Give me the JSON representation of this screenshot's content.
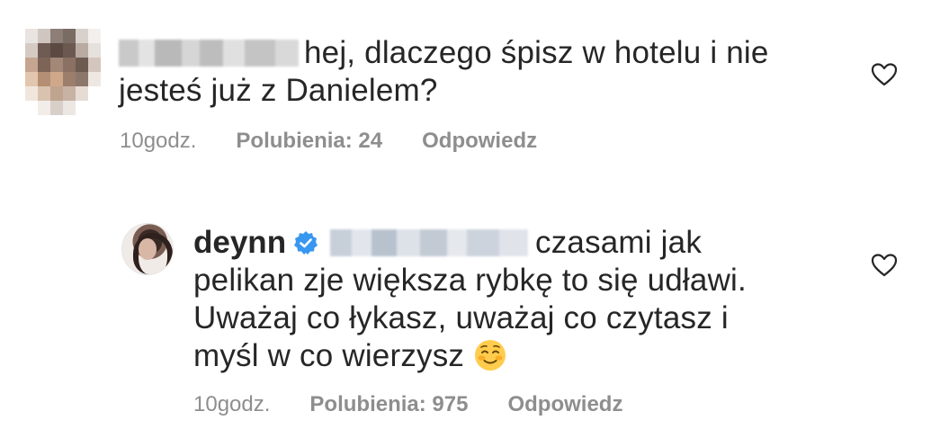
{
  "comment": {
    "text_line1": "hej, dlaczego śpisz w hotelu i nie",
    "text_line2": "jesteś już z Danielem?",
    "time": "10godz.",
    "likes": "Polubienia: 24",
    "reply": "Odpowiedz"
  },
  "reply_comment": {
    "username": "deynn",
    "verified": true,
    "text_line1": "czasami jak",
    "text_line2": "pelikan zje większa rybkę to się udławi.",
    "text_line3": "Uważaj co łykasz, uważaj co czytasz i",
    "text_line4": "myśl w co wierzysz",
    "emoji": "smiling-face-emoji",
    "time": "10godz.",
    "likes": "Polubienia: 975",
    "reply": "Odpowiedz"
  },
  "icons": {
    "heart": "heart-outline-icon",
    "verified": "verified-badge-icon"
  },
  "colors": {
    "text": "#262626",
    "meta": "#8e8e8e",
    "verified": "#3897f0"
  }
}
